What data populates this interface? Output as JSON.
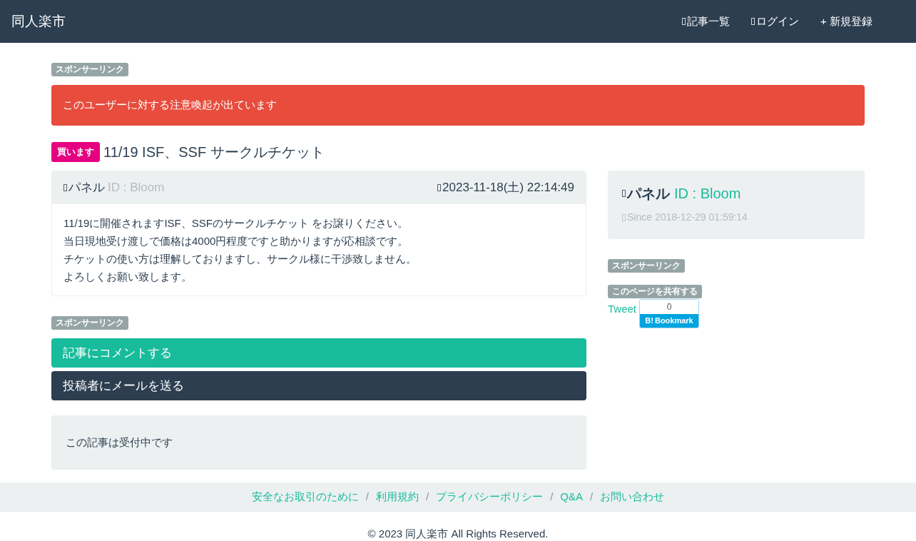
{
  "navbar": {
    "brand": "同人楽市",
    "items": [
      {
        "icon": true,
        "label": "記事一覧"
      },
      {
        "icon": true,
        "label": "ログイン"
      },
      {
        "icon": false,
        "label": "+ 新規登録"
      }
    ]
  },
  "sponsor_top": "スポンサーリンク",
  "alert": "このユーザーに対する注意喚起が出ています",
  "post": {
    "badge": "買います",
    "title": "11/19 ISF、SSF サークルチケット",
    "author": "パネル",
    "author_id": "ID : Bloom",
    "date": "2023-11-18(土) 22:14:49",
    "body": [
      "11/19に開催されますISF、SSFのサークルチケット をお譲りください。",
      "当日現地受け渡しで価格は4000円程度ですと助かりますが応相談です。",
      "チケットの使い方は理解しておりますし、サークル様に干渉致しません。",
      "よろしくお願い致します。"
    ]
  },
  "sponsor_bottom": "スポンサーリンク",
  "buttons": [
    {
      "kind": "primary",
      "label": "記事にコメントする"
    },
    {
      "kind": "dark",
      "label": "投稿者にメールを送る"
    }
  ],
  "status": "この記事は受付中です",
  "profile": {
    "name": "パネル",
    "id": "ID : Bloom",
    "since": "Since 2018-12-29 01:59:14"
  },
  "sponsor_side": "スポンサーリンク",
  "share": {
    "label": "このページを共有する",
    "tweet": "Tweet",
    "count": "0",
    "bookmark_mark": "B!",
    "bookmark": "Bookmark"
  },
  "footer": {
    "items": [
      {
        "kind": "link",
        "text": "安全なお取引のために"
      },
      {
        "kind": "separator",
        "text": "/"
      },
      {
        "kind": "link",
        "text": "利用規約"
      },
      {
        "kind": "separator",
        "text": "/"
      },
      {
        "kind": "link",
        "text": "プライバシーポリシー"
      },
      {
        "kind": "separator",
        "text": "/"
      },
      {
        "kind": "link",
        "text": "Q&A"
      },
      {
        "kind": "separator",
        "text": "/"
      },
      {
        "kind": "link",
        "text": "お問い合わせ"
      }
    ],
    "copyright": "© 2023 同人楽市 All Rights Reserved."
  }
}
